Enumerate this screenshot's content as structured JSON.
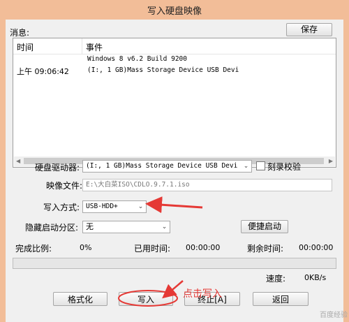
{
  "window": {
    "title": "写入硬盘映像"
  },
  "messages": {
    "label": "消息:",
    "save_button": "保存",
    "columns": {
      "time": "时间",
      "event": "事件"
    },
    "rows": [
      {
        "time": "",
        "event": "Windows 8 v6.2 Build 9200"
      },
      {
        "time": "上午 09:06:42",
        "event": "(I:, 1 GB)Mass Storage Device USB Devi"
      }
    ]
  },
  "drive": {
    "label": "硬盘驱动器:",
    "value": "(I:, 1 GB)Mass Storage Device USB Devi",
    "verify_label": "刻录校验",
    "verify_checked": false
  },
  "image_file": {
    "label": "映像文件:",
    "value": "E:\\大白菜ISO\\CDLO.9.7.1.iso"
  },
  "write_mode": {
    "label": "写入方式:",
    "value": "USB-HDD+"
  },
  "hidden_partition": {
    "label": "隐藏启动分区:",
    "value": "无",
    "quick_boot_button": "便捷启动"
  },
  "status": {
    "progress_label": "完成比例:",
    "progress_value": "0%",
    "elapsed_label": "已用时间:",
    "elapsed_value": "00:00:00",
    "remaining_label": "剩余时间:",
    "remaining_value": "00:00:00",
    "progress_fraction": 0,
    "speed_label": "速度:",
    "speed_value": "0KB/s"
  },
  "buttons": {
    "format": "格式化",
    "write": "写入",
    "stop": "终止[A]",
    "back": "返回"
  },
  "annotation": {
    "text": "点击写入",
    "color": "#e53935"
  },
  "watermark": "百度经验"
}
